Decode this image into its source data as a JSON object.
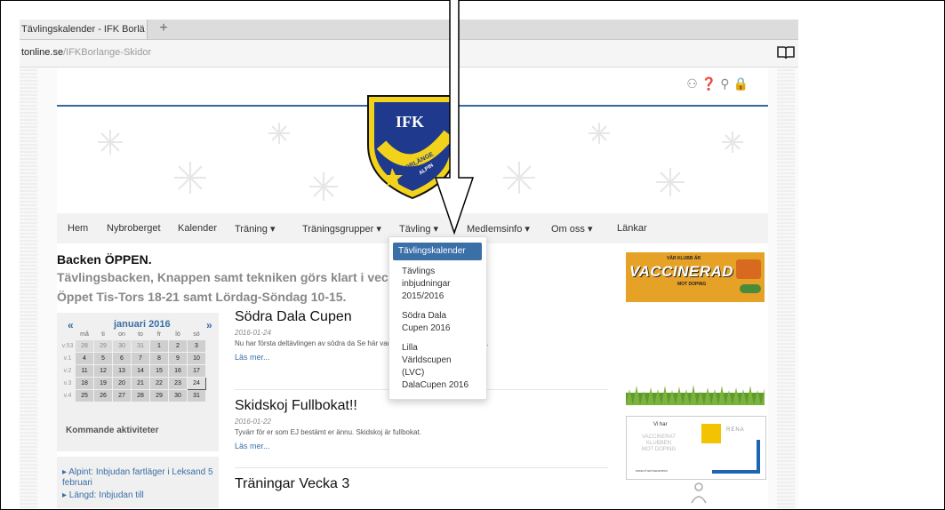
{
  "browser": {
    "tab_title": "Tävlingskalender - IFK Borlä",
    "new_tab_symbol": "+",
    "url_domain": "tonline.se",
    "url_path": "/IFKBorlange-Skidor"
  },
  "site": {
    "logo_text_top": "IFK",
    "logo_text_ring": "BORLÄNGE",
    "logo_text_alpin": "ALPIN",
    "util_icons": [
      "sitemap-icon",
      "help-icon",
      "search-icon",
      "lock-icon"
    ]
  },
  "nav": {
    "items": [
      {
        "label": "Hem",
        "caret": ""
      },
      {
        "label": "Nybroberget",
        "caret": ""
      },
      {
        "label": "Kalender",
        "caret": ""
      },
      {
        "label": "Träning",
        "caret": "▾"
      },
      {
        "label": "Träningsgrupper",
        "caret": "▾"
      },
      {
        "label": "Tävling",
        "caret": "▾"
      },
      {
        "label": "Medlemsinfo",
        "caret": "▾"
      },
      {
        "label": "Om oss",
        "caret": "▾"
      },
      {
        "label": "Länkar",
        "caret": ""
      }
    ],
    "dropdown": {
      "items": [
        "Tävlingskalender",
        "Tävlings\ninbjudningar\n2015/2016",
        "Södra Dala\nCupen 2016",
        "Lilla\nVärldscupen\n(LVC)\nDalaCupen 2016"
      ]
    }
  },
  "notice": {
    "line1": "Backen ÖPPEN.",
    "line2": "Tävlingsbacken, Knappen samt tekniken görs klart i veckan",
    "line3": "Öppet Tis-Tors 18-21 samt Lördag-Söndag 10-15."
  },
  "calendar": {
    "prev": "«",
    "next": "»",
    "title": "januari 2016",
    "days": [
      "må",
      "ti",
      "on",
      "to",
      "fr",
      "lö",
      "sö"
    ],
    "weeks": [
      {
        "wk": "v.53",
        "days": [
          "28",
          "29",
          "30",
          "31",
          "1",
          "2",
          "3"
        ]
      },
      {
        "wk": "v.1",
        "days": [
          "4",
          "5",
          "6",
          "7",
          "8",
          "9",
          "10"
        ]
      },
      {
        "wk": "v.2",
        "days": [
          "11",
          "12",
          "13",
          "14",
          "15",
          "16",
          "17"
        ]
      },
      {
        "wk": "v.3",
        "days": [
          "18",
          "19",
          "20",
          "21",
          "22",
          "23",
          "24"
        ]
      },
      {
        "wk": "v.4",
        "days": [
          "25",
          "26",
          "27",
          "28",
          "29",
          "30",
          "31"
        ]
      }
    ]
  },
  "upcoming": {
    "title": "Kommande aktiviteter",
    "items": [
      "▸ Alpint: Inbjudan fartläger i Leksand 5 februari",
      "▸ Längd: Inbjudan till"
    ]
  },
  "posts": [
    {
      "title": "Södra Dala Cupen",
      "date": "2016-01-24",
      "body": "Nu har första deltävlingen av södra da                              Se här vad Södra Dalacupen är för något.",
      "more": "Läs mer..."
    },
    {
      "title": "Skidskoj Fullbokat!!",
      "date": "2016-01-22",
      "body": "Tyvärr för er som EJ bestämt er ännu. Skidskoj är fullbokat.",
      "more": "Läs mer..."
    },
    {
      "title": "Träningar Vecka 3",
      "date": "",
      "body": "",
      "more": ""
    }
  ],
  "ads": {
    "ad1_top": "VÅR KLUBB ÄR",
    "ad1_big": "VACCINERAD",
    "ad1_sub": "MOT DOPING",
    "ad2_head": "Vi har",
    "ad2_body": "VACCINERAT\nKLUBBEN\nMOT DOPING",
    "ad2_brand": "RENA",
    "ad2_url": "www.rf.se/vaccinera"
  }
}
